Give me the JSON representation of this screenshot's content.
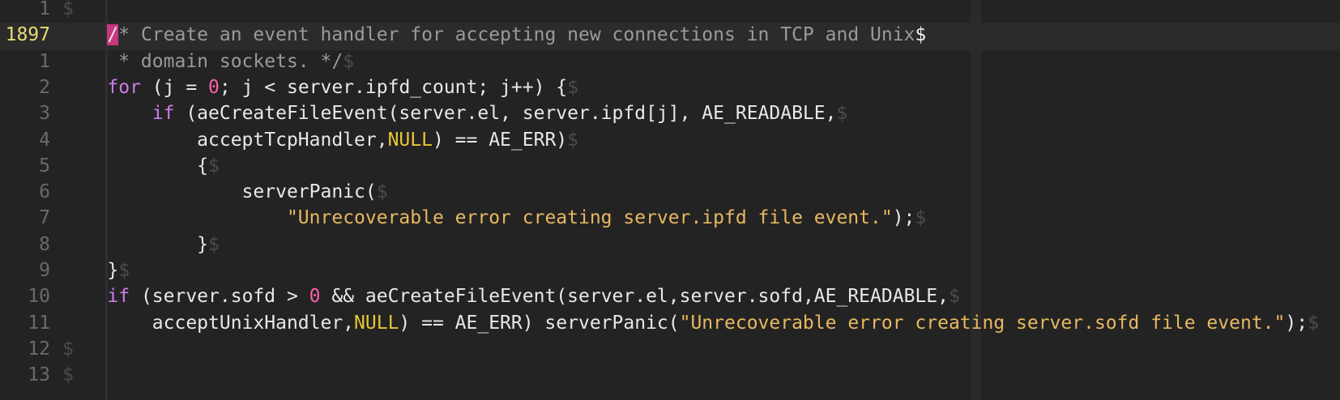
{
  "editor": {
    "current_line_number": "1897",
    "lines": [
      {
        "number": "1",
        "relative": true,
        "tokens": [
          {
            "t": "$",
            "c": "eol"
          }
        ]
      },
      {
        "number": "1897",
        "relative": false,
        "tokens": [
          {
            "t": "    ",
            "c": "text"
          },
          {
            "t": "/",
            "c": "cursor"
          },
          {
            "t": "* Create an event handler for accepting new connections in TCP and Unix",
            "c": "comment"
          },
          {
            "t": "$",
            "c": "eolbright"
          }
        ]
      },
      {
        "number": "1",
        "relative": true,
        "tokens": [
          {
            "t": "     * domain sockets. */",
            "c": "comment"
          },
          {
            "t": "$",
            "c": "eol"
          }
        ]
      },
      {
        "number": "2",
        "relative": true,
        "tokens": [
          {
            "t": "    ",
            "c": "text"
          },
          {
            "t": "for",
            "c": "keyword"
          },
          {
            "t": " (j = ",
            "c": "text"
          },
          {
            "t": "0",
            "c": "number"
          },
          {
            "t": "; j < server.ipfd_count; j++) {",
            "c": "text"
          },
          {
            "t": "$",
            "c": "eol"
          }
        ]
      },
      {
        "number": "3",
        "relative": true,
        "tokens": [
          {
            "t": "        ",
            "c": "text"
          },
          {
            "t": "if",
            "c": "keyword"
          },
          {
            "t": " (aeCreateFileEvent(server.el, server.ipfd[j], AE_READABLE,",
            "c": "text"
          },
          {
            "t": "$",
            "c": "eol"
          }
        ]
      },
      {
        "number": "4",
        "relative": true,
        "tokens": [
          {
            "t": "            acceptTcpHandler,",
            "c": "text"
          },
          {
            "t": "NULL",
            "c": "const"
          },
          {
            "t": ") == AE_ERR)",
            "c": "text"
          },
          {
            "t": "$",
            "c": "eol"
          }
        ]
      },
      {
        "number": "5",
        "relative": true,
        "tokens": [
          {
            "t": "            {",
            "c": "text"
          },
          {
            "t": "$",
            "c": "eol"
          }
        ]
      },
      {
        "number": "6",
        "relative": true,
        "tokens": [
          {
            "t": "                serverPanic(",
            "c": "text"
          },
          {
            "t": "$",
            "c": "eol"
          }
        ]
      },
      {
        "number": "7",
        "relative": true,
        "tokens": [
          {
            "t": "                    ",
            "c": "text"
          },
          {
            "t": "\"Unrecoverable error creating server.ipfd file event.\"",
            "c": "string"
          },
          {
            "t": ");",
            "c": "text"
          },
          {
            "t": "$",
            "c": "eol"
          }
        ]
      },
      {
        "number": "8",
        "relative": true,
        "tokens": [
          {
            "t": "            }",
            "c": "text"
          },
          {
            "t": "$",
            "c": "eol"
          }
        ]
      },
      {
        "number": "9",
        "relative": true,
        "tokens": [
          {
            "t": "    }",
            "c": "text"
          },
          {
            "t": "$",
            "c": "eol"
          }
        ]
      },
      {
        "number": "10",
        "relative": true,
        "tokens": [
          {
            "t": "    ",
            "c": "text"
          },
          {
            "t": "if",
            "c": "keyword"
          },
          {
            "t": " (server.sofd > ",
            "c": "text"
          },
          {
            "t": "0",
            "c": "number"
          },
          {
            "t": " && aeCreateFileEvent(server.el,server.sofd,AE_READABLE,",
            "c": "text"
          },
          {
            "t": "$",
            "c": "eol"
          }
        ]
      },
      {
        "number": "11",
        "relative": true,
        "tokens": [
          {
            "t": "        acceptUnixHandler,",
            "c": "text"
          },
          {
            "t": "NULL",
            "c": "const"
          },
          {
            "t": ") == AE_ERR) serverPanic(",
            "c": "text"
          },
          {
            "t": "\"Unrecoverable error creating server.sofd file event.\"",
            "c": "string"
          },
          {
            "t": ");",
            "c": "text"
          },
          {
            "t": "$",
            "c": "eol"
          }
        ]
      },
      {
        "number": "12",
        "relative": true,
        "tokens": [
          {
            "t": "$",
            "c": "eol"
          }
        ]
      },
      {
        "number": "13",
        "relative": true,
        "tokens": [
          {
            "t": "$",
            "c": "eol"
          }
        ]
      }
    ]
  },
  "colors": {
    "background": "#232323",
    "line_number": "#6a6a6a",
    "current_line_number": "#e6db74",
    "keyword": "#cc7de8",
    "number": "#ff5fa8",
    "constant": "#e9c435",
    "string": "#e8b860",
    "comment": "#9a9a9a",
    "cursor": "#c8377e"
  }
}
